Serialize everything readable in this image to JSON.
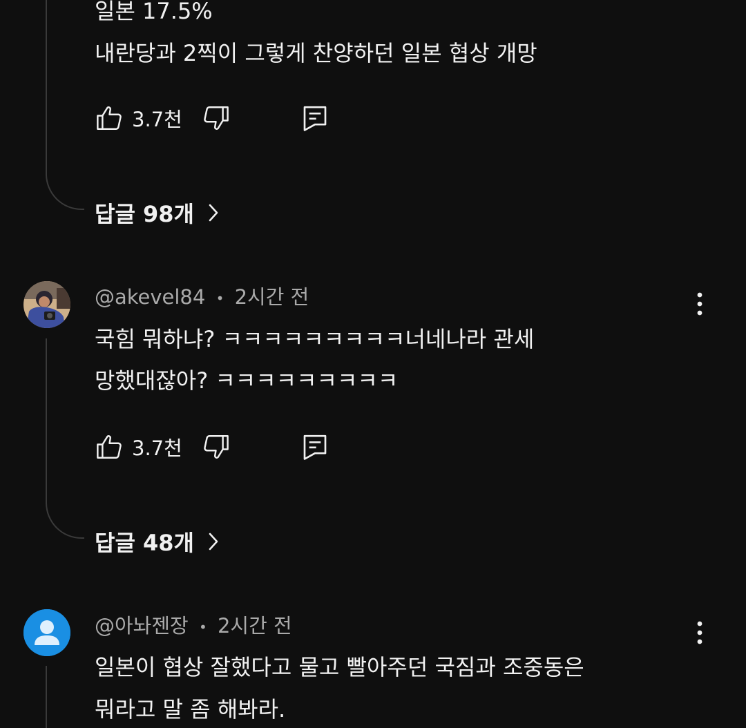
{
  "comment_top": {
    "text_lines": [
      "일본 17.5%",
      "내란당과 2찍이 그렇게 찬양하던 일본 협상 개망"
    ],
    "likes": "3.7천",
    "replies_label": "답글 98개"
  },
  "comment_2": {
    "handle": "@akevel84",
    "time": "2시간 전",
    "separator": "•",
    "text_lines": [
      "국힘 뭐하냐? ㅋㅋㅋㅋㅋㅋㅋㅋㅋ너네나라 관세",
      "망했대잖아? ㅋㅋㅋㅋㅋㅋㅋㅋㅋ"
    ],
    "likes": "3.7천",
    "replies_label": "답글 48개"
  },
  "comment_3": {
    "handle": "@아놔젠장",
    "time": "2시간 전",
    "separator": "•",
    "text_lines": [
      "일본이 협상 잘했다고 물고 빨아주던 국짐과 조중동은",
      "뭐라고 말 좀 해봐라."
    ]
  },
  "icons": {
    "like": "thumbs-up-icon",
    "dislike": "thumbs-down-icon",
    "reply": "comment-reply-icon",
    "more": "more-vertical-icon",
    "chevron": "chevron-right-icon",
    "avatar_default": "person-icon"
  },
  "colors": {
    "background": "#0f0f0f",
    "text": "#f1f1f1",
    "meta": "#aaaaaa",
    "thread_line": "#3a3a3a",
    "default_avatar": "#1a8fe3"
  }
}
